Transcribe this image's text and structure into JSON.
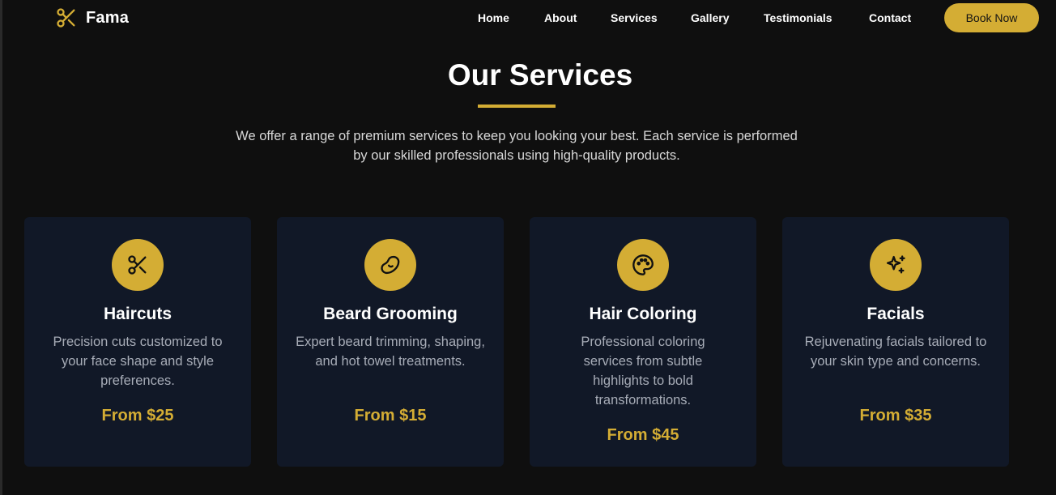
{
  "brand": {
    "name": "Fama",
    "logo_icon": "scissors-icon"
  },
  "nav": {
    "links": [
      "Home",
      "About",
      "Services",
      "Gallery",
      "Testimonials",
      "Contact"
    ],
    "cta_label": "Book Now"
  },
  "services_section": {
    "title": "Our Services",
    "intro": "We offer a range of premium services to keep you looking your best. Each service is performed by our skilled professionals using high-quality products.",
    "cards": [
      {
        "icon": "scissors-icon",
        "title": "Haircuts",
        "description": "Precision cuts customized to your face shape and style preferences.",
        "price": "From $25"
      },
      {
        "icon": "beard-icon",
        "title": "Beard Grooming",
        "description": "Expert beard trimming, shaping, and hot towel treatments.",
        "price": "From $15"
      },
      {
        "icon": "palette-icon",
        "title": "Hair Coloring",
        "description": "Professional coloring services from subtle highlights to bold transformations.",
        "price": "From $45"
      },
      {
        "icon": "sparkles-icon",
        "title": "Facials",
        "description": "Rejuvenating facials tailored to your skin type and concerns.",
        "price": "From $35"
      }
    ]
  },
  "colors": {
    "background": "#0f0f0f",
    "accent": "#d4ad34",
    "card_background": "#111827",
    "muted_text": "#a7acb7"
  }
}
